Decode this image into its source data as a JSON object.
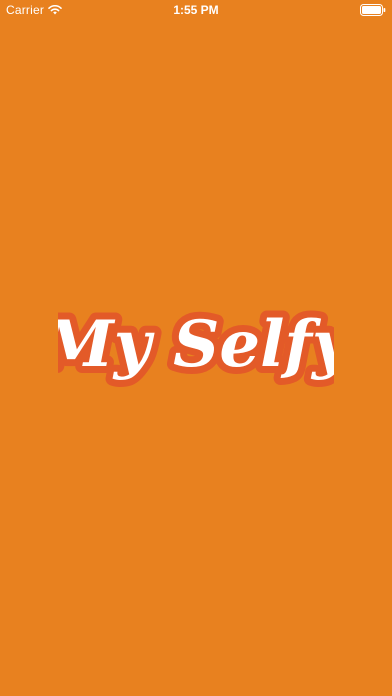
{
  "status_bar": {
    "carrier": "Carrier",
    "time": "1:55 PM",
    "wifi_icon": "wifi-icon",
    "battery_icon": "battery-icon"
  },
  "splash": {
    "logo_text": "My Selfy",
    "background_color": "#e8811f",
    "logo_fill_color": "#ffffff",
    "logo_outline_color": "#e35a28"
  }
}
